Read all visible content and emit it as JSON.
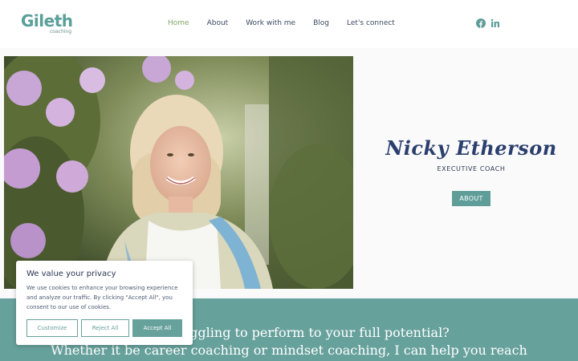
{
  "header": {
    "logo_text": "Gileth",
    "logo_subtext": "coaching",
    "nav": [
      {
        "label": "Home",
        "active": true
      },
      {
        "label": "About",
        "active": false
      },
      {
        "label": "Work with me",
        "active": false
      },
      {
        "label": "Blog",
        "active": false
      },
      {
        "label": "Let's connect",
        "active": false
      }
    ],
    "social": [
      "facebook-icon",
      "linkedin-icon"
    ]
  },
  "hero": {
    "name": "Nicky Etherson",
    "role": "EXECUTIVE COACH",
    "about_button": "ABOUT"
  },
  "banner": {
    "line1": "ruggling to perform to your full potential?",
    "line2": "Whether it be career coaching or mindset coaching, I can help you reach"
  },
  "cookie": {
    "title": "We value your privacy",
    "text": "We use cookies to enhance your browsing experience and analyze our traffic. By clicking \"Accept All\", you consent to our use of cookies.",
    "customize": "Customize",
    "reject": "Reject All",
    "accept": "Accept All"
  },
  "colors": {
    "teal": "#67a19c",
    "nav_active": "#7fa765",
    "name": "#2a3f6e"
  }
}
